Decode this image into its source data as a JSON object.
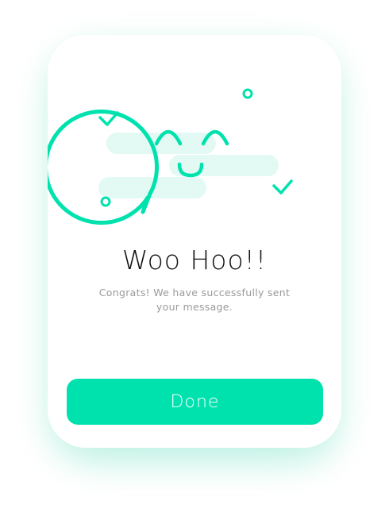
{
  "dialog": {
    "title": "Woo Hoo!!",
    "message": "Congrats! We have successfully sent your message.",
    "button_label": "Done"
  },
  "illustration": {
    "icon": "smiling-chat-bubble-icon",
    "decorations": [
      "check-icon",
      "check-icon",
      "ring-icon",
      "ring-icon"
    ]
  },
  "colors": {
    "accent": "#00E2AE",
    "accent_light": "#E2FAF3",
    "title_text": "#111111",
    "message_text": "#9A9A9A",
    "button_text": "#FFFFFF",
    "background": "#FFFFFF"
  }
}
